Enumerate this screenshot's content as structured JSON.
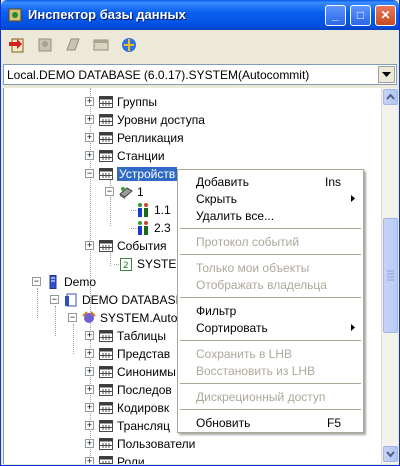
{
  "window": {
    "title": "Инспектор базы данных",
    "minimize_label": "_",
    "maximize_label": "□",
    "close_label": "✕"
  },
  "toolbar": {
    "buttons": [
      "new-object-icon",
      "user-icon",
      "script-icon",
      "window-icon",
      "database-icon"
    ]
  },
  "database_combo": {
    "value": "Local.DEMO DATABASE (6.0.17).SYSTEM(Autocommit)"
  },
  "tree": {
    "items": [
      {
        "label": "Группы",
        "icon": "folder-icon"
      },
      {
        "label": "Уровни доступа",
        "icon": "folder-icon"
      },
      {
        "label": "Репликация",
        "icon": "folder-icon"
      },
      {
        "label": "Станции",
        "icon": "folder-icon"
      },
      {
        "label": "Устройств",
        "icon": "folder-icon",
        "selected": true
      },
      {
        "label": "1",
        "icon": "device-icon"
      },
      {
        "label": "1.1",
        "icon": "users-icon"
      },
      {
        "label": "2.3",
        "icon": "users-icon"
      },
      {
        "label": "События",
        "icon": "folder-icon"
      },
      {
        "label": "SYSTEM",
        "icon": "event-icon"
      },
      {
        "label": "Demo",
        "icon": "server-icon"
      },
      {
        "label": "DEMO DATABASE",
        "icon": "database-icon"
      },
      {
        "label": "SYSTEM.Auto",
        "icon": "connection-icon"
      },
      {
        "label": "Таблицы",
        "icon": "folder-icon"
      },
      {
        "label": "Представ",
        "icon": "folder-icon"
      },
      {
        "label": "Синонимы",
        "icon": "folder-icon"
      },
      {
        "label": "Последов",
        "icon": "folder-icon"
      },
      {
        "label": "Кодировк",
        "icon": "folder-icon"
      },
      {
        "label": "Трансляц",
        "icon": "folder-icon"
      },
      {
        "label": "Пользователи",
        "icon": "folder-icon"
      },
      {
        "label": "Роли",
        "icon": "folder-icon"
      }
    ]
  },
  "context_menu": {
    "items": [
      {
        "label": "Добавить",
        "shortcut": "Ins"
      },
      {
        "label": "Скрыть",
        "submenu": true
      },
      {
        "label": "Удалить все..."
      },
      {
        "separator": true
      },
      {
        "label": "Протокол событий",
        "disabled": true
      },
      {
        "separator": true
      },
      {
        "label": "Только мои объекты",
        "disabled": true
      },
      {
        "label": "Отображать владельца",
        "disabled": true
      },
      {
        "separator": true
      },
      {
        "label": "Фильтр"
      },
      {
        "label": "Сортировать",
        "submenu": true
      },
      {
        "separator": true
      },
      {
        "label": "Сохранить в LHB",
        "disabled": true
      },
      {
        "label": "Восстановить из LHB",
        "disabled": true
      },
      {
        "separator": true
      },
      {
        "label": "Дискреционный доступ",
        "disabled": true
      },
      {
        "separator": true
      },
      {
        "label": "Обновить",
        "shortcut": "F5"
      }
    ]
  },
  "colors": {
    "title_bar": "#0a5ae8",
    "selection": "#316ac5",
    "disabled_text": "#aca899"
  }
}
